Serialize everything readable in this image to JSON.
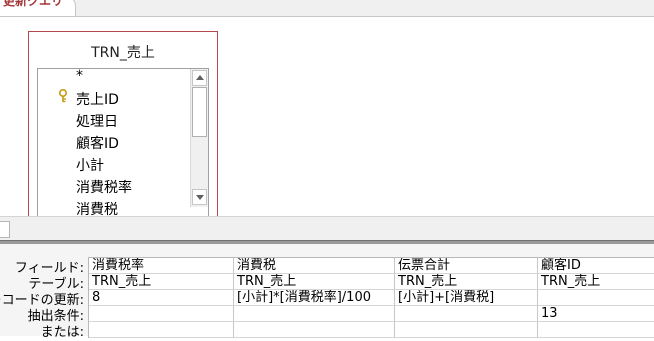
{
  "tab": {
    "label": "更新クエリ"
  },
  "table_box": {
    "title": "TRN_売上",
    "fields": [
      "*",
      "売上ID",
      "処理日",
      "顧客ID",
      "小計",
      "消費税率",
      "消費税"
    ]
  },
  "grid": {
    "row_labels": [
      "フィールド:",
      "テーブル:",
      "レコードの更新:",
      "抽出条件:",
      "または:"
    ],
    "columns": [
      {
        "field": "消費税率",
        "table": "TRN_売上",
        "update": "8",
        "criteria": ""
      },
      {
        "field": "消費税",
        "table": "TRN_売上",
        "update": "[小計]*[消費税率]/100",
        "criteria": ""
      },
      {
        "field": "伝票合計",
        "table": "TRN_売上",
        "update": "[小計]+[消費税]",
        "criteria": ""
      },
      {
        "field": "顧客ID",
        "table": "TRN_売上",
        "update": "",
        "criteria": "13"
      }
    ]
  },
  "colors": {
    "tab_text": "#a4373a",
    "table_border": "#b5484c",
    "key_icon": "#c49a16"
  },
  "icons": {
    "primary_key": "key-icon"
  }
}
